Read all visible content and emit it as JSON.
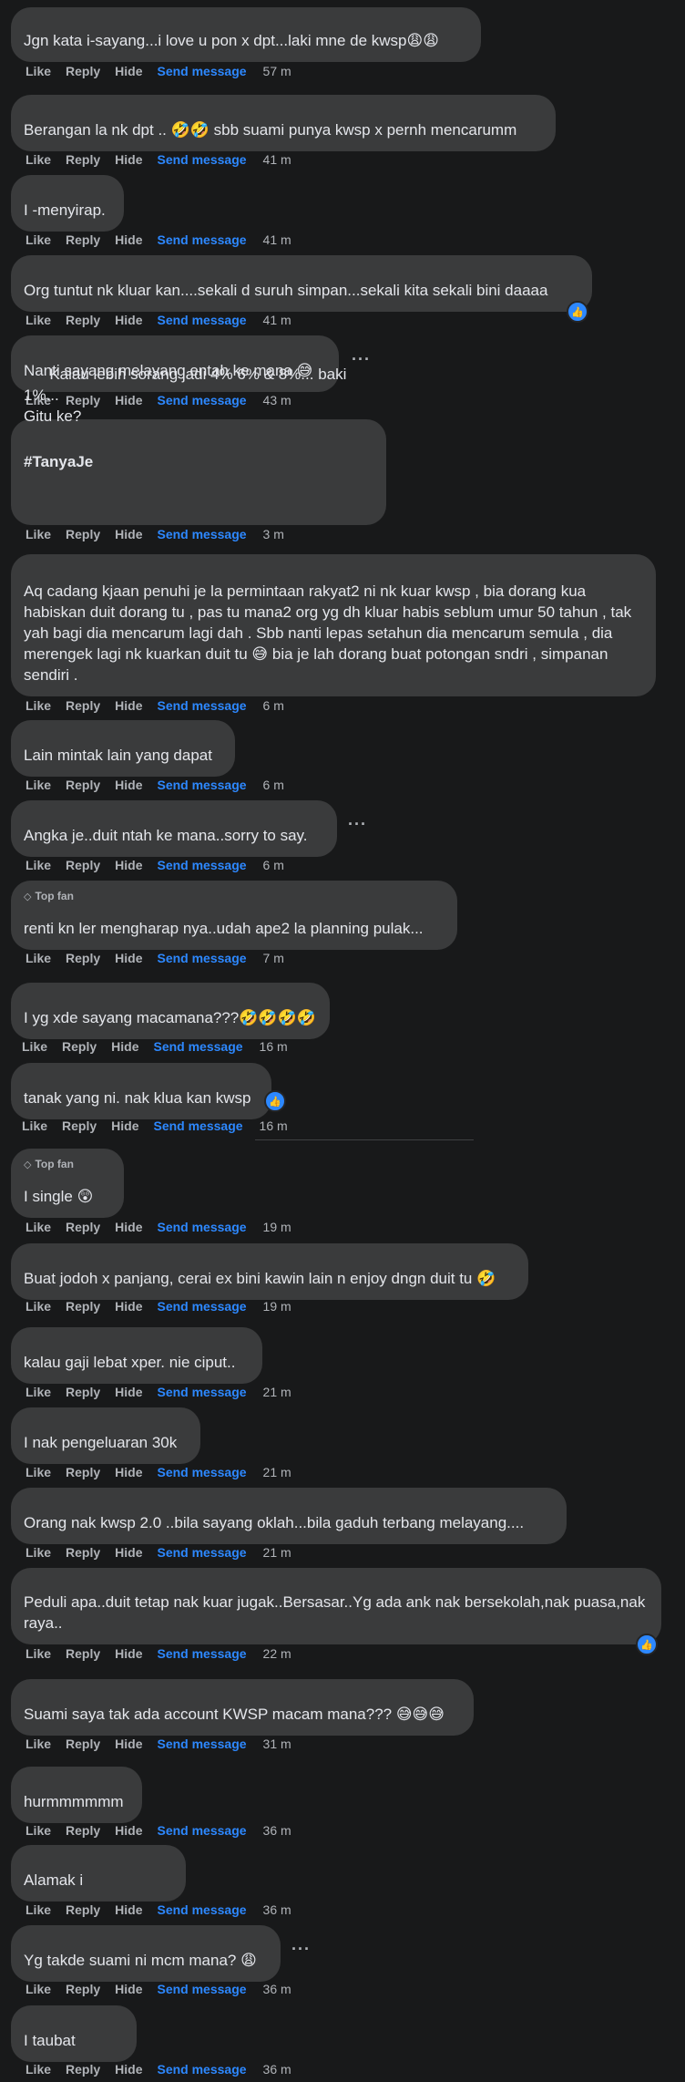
{
  "actions": {
    "like": "Like",
    "reply": "Reply",
    "hide": "Hide",
    "send": "Send message"
  },
  "badge_top_fan": "Top fan",
  "comments": [
    {
      "text": "Jgn kata i-sayang...i love u pon x dpt...laki mne de kwsp😩😩",
      "time": "57 m"
    },
    {
      "text": "Berangan la nk dpt .. 🤣🤣 sbb suami punya kwsp x pernh mencarumm",
      "time": "41 m"
    },
    {
      "text": "I -menyirap.",
      "time": "41 m"
    },
    {
      "text": "Org tuntut nk kluar kan....sekali d suruh simpan...sekali kita sekali bini daaaa",
      "time": "41 m"
    },
    {
      "text": "Nanti sayang melayang entah ke mana 😅",
      "time": "43 m"
    },
    {
      "text": "Kalau lebih sorang jadi 4% 6% & 8%... baki 1%...\nGitu ke?",
      "tag": "#TanyaJe",
      "time": "3 m"
    },
    {
      "text": "Aq cadang kjaan penuhi je la permintaan rakyat2 ni nk kuar kwsp , bia dorang kua habiskan duit dorang tu , pas tu mana2 org yg dh kluar habis seblum umur 50 tahun , tak yah bagi dia mencarum lagi dah . Sbb nanti lepas setahun dia mencarum semula , dia merengek lagi nk kuarkan duit tu 😅 bia je lah dorang buat potongan sndri , simpanan sendiri .",
      "time": "6 m"
    },
    {
      "text": "Lain mintak lain yang dapat",
      "time": "6 m"
    },
    {
      "text": "Angka je..duit ntah ke mana..sorry to say.",
      "time": "6 m"
    },
    {
      "text": "renti kn ler mengharap nya..udah ape2 la planning pulak...",
      "time": "7 m"
    },
    {
      "text": "I yg xde sayang macamana???🤣🤣🤣🤣",
      "time": "16 m"
    },
    {
      "text": "tanak yang ni. nak klua kan kwsp",
      "time": "16 m"
    },
    {
      "text": "I single 😲",
      "time": "19 m"
    },
    {
      "text": "Buat jodoh x panjang, cerai ex bini kawin lain n enjoy dngn duit tu 🤣",
      "time": "19 m"
    },
    {
      "text": "kalau gaji lebat xper. nie ciput..",
      "time": "21 m"
    },
    {
      "text": "I nak pengeluaran 30k",
      "time": "21 m"
    },
    {
      "text": "Orang nak kwsp 2.0 ..bila sayang oklah...bila gaduh terbang melayang....",
      "time": "21 m"
    },
    {
      "text": "Peduli apa..duit tetap nak kuar jugak..Bersasar..Yg ada ank nak bersekolah,nak puasa,nak raya..",
      "time": "22 m"
    },
    {
      "text": "Suami saya tak ada account KWSP macam mana??? 😅😅😅",
      "time": "31 m"
    },
    {
      "text": "hurmmmmmm",
      "time": "36 m"
    },
    {
      "text": "Alamak i",
      "time": "36 m"
    },
    {
      "text": "Yg takde suami ni mcm mana? 😩",
      "time": "36 m"
    },
    {
      "text": "I taubat",
      "time": "36 m"
    }
  ],
  "more_icon": "···",
  "like_reaction_icon": "👍"
}
